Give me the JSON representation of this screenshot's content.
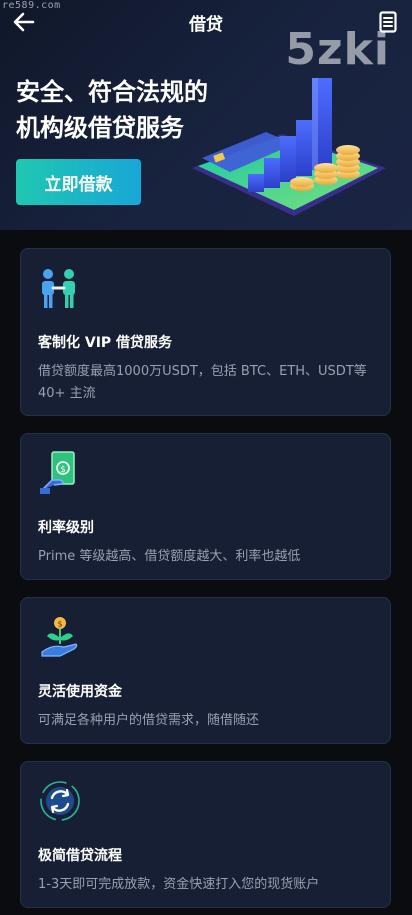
{
  "watermark": {
    "site_text": "re589.com",
    "brand_text": "5zki"
  },
  "header": {
    "title": "借贷"
  },
  "hero": {
    "headline_line1": "安全、符合法规的",
    "headline_line2": "机构级借贷服务",
    "cta_label": "立即借款"
  },
  "features": [
    {
      "icon": "handshake-people-icon",
      "title": "客制化 VIP 借贷服务",
      "desc": "借贷额度最高1000万USDT，包括 BTC、ETH、USDT等40+ 主流"
    },
    {
      "icon": "cash-hand-icon",
      "title": "利率级别",
      "desc": "Prime 等级越高、借贷额度越大、利率也越低"
    },
    {
      "icon": "plant-hand-icon",
      "title": "灵活使用资金",
      "desc": "可满足各种用户的借贷需求，随借随还"
    },
    {
      "icon": "cycle-icon",
      "title": "极简借贷流程",
      "desc": "1-3天即可完成放款，资金快速打入您的现货账户"
    }
  ],
  "colors": {
    "accent_start": "#1fc7b0",
    "accent_end": "#18a7d8",
    "card_bg": "#161f33",
    "page_bg": "#0b0c10"
  }
}
